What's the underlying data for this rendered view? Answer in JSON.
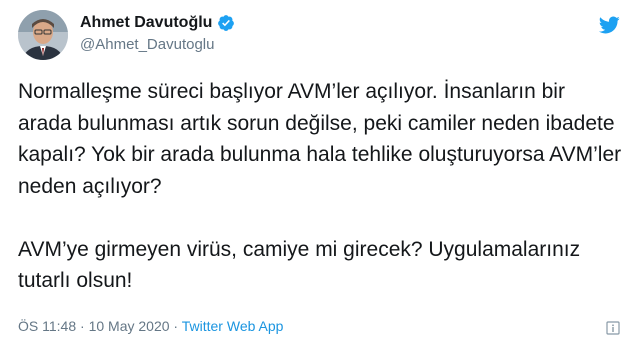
{
  "author": {
    "display_name": "Ahmet Davutoğlu",
    "handle": "@Ahmet_Davutoglu",
    "avatar_icon": "profile-photo",
    "verified_icon": "verified-badge-icon"
  },
  "tweet": {
    "text": "Normalleşme süreci başlıyor AVM’ler açılıyor. İnsanların bir arada bulunması artık sorun değilse, peki camiler neden ibadete kapalı? Yok bir arada bulunma hala tehlike oluşturuyorsa AVM’ler neden açılıyor?\n\nAVM’ye girmeyen virüs, camiye mi girecek? Uygulamalarınız tutarlı olsun!",
    "time": "ÖS 11:48",
    "separator": "·",
    "date": "10 May 2020",
    "source": "Twitter Web App"
  },
  "colors": {
    "link": "#1b95e0",
    "verified": "#1da1f2",
    "muted": "#657786",
    "text": "#14171a"
  },
  "icons": {
    "brand": "twitter-bird-icon",
    "info": "ad-info-icon"
  }
}
